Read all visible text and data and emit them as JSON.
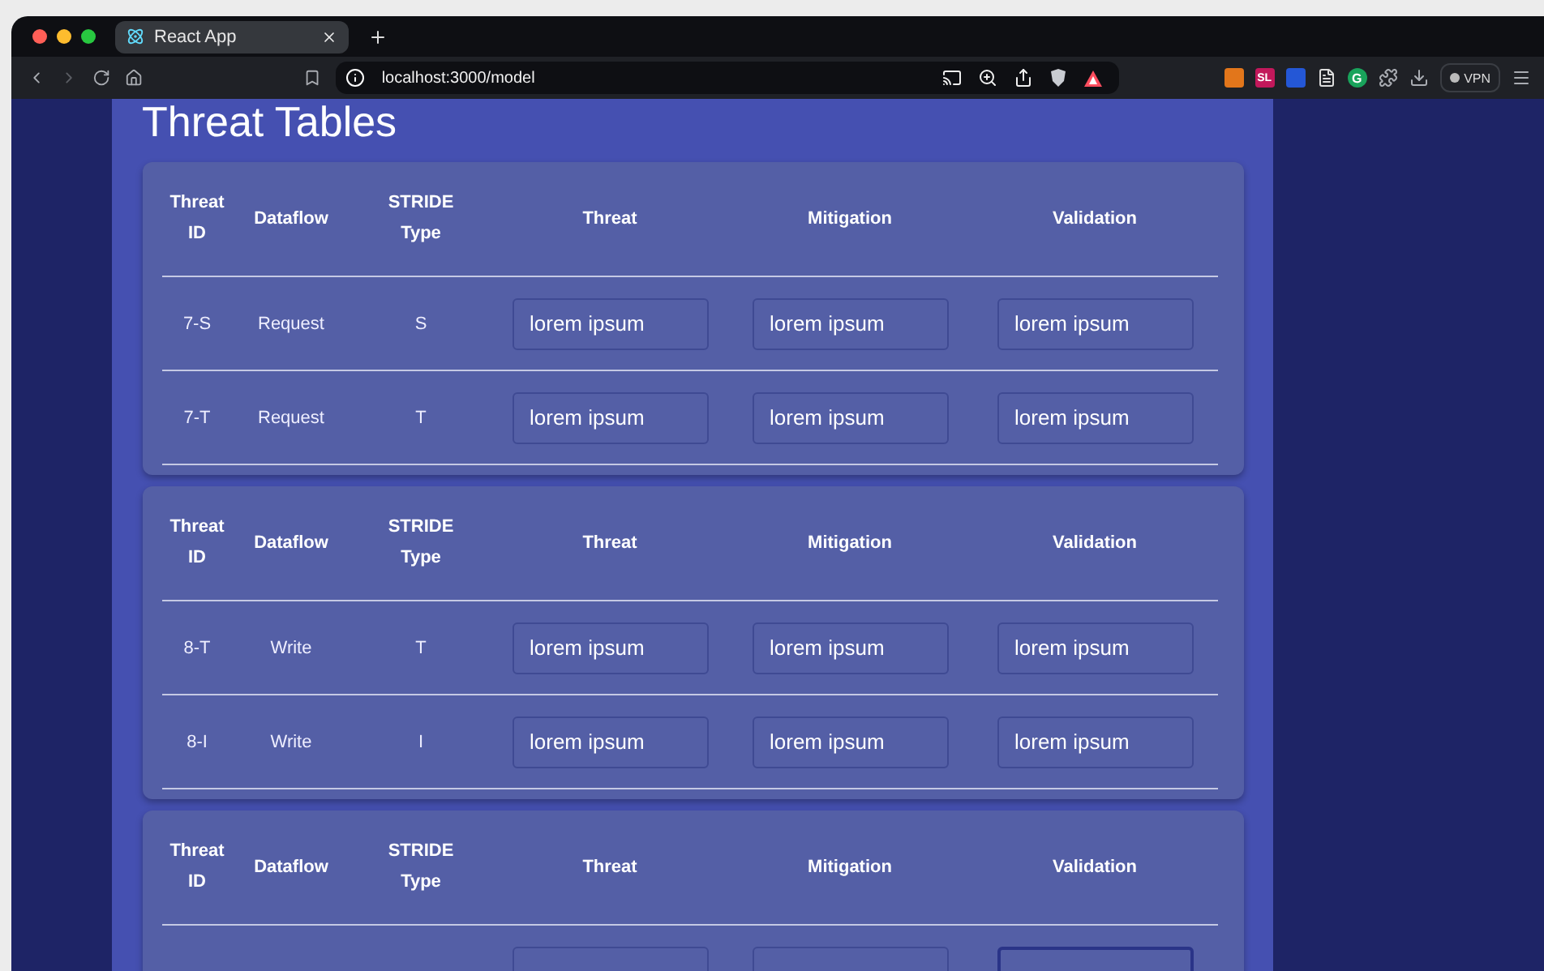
{
  "browser": {
    "tab_title": "React App",
    "url": "localhost:3000/model",
    "extensions": [
      "SL",
      "G"
    ],
    "vpn_label": "VPN"
  },
  "page": {
    "title": "Threat Tables",
    "tables": [
      {
        "columns": [
          "Threat ID",
          "Dataflow",
          "STRIDE Type",
          "Threat",
          "Mitigation",
          "Validation"
        ],
        "rows": [
          {
            "id": "7-S",
            "dataflow": "Request",
            "stride": "S",
            "fields": [
              {
                "value": "lorem ipsum",
                "focused": false
              },
              {
                "value": "lorem ipsum",
                "focused": false
              },
              {
                "value": "lorem ipsum",
                "focused": false
              }
            ]
          },
          {
            "id": "7-T",
            "dataflow": "Request",
            "stride": "T",
            "fields": [
              {
                "value": "lorem ipsum",
                "focused": false
              },
              {
                "value": "lorem ipsum",
                "focused": false
              },
              {
                "value": "lorem ipsum",
                "focused": false
              }
            ]
          }
        ]
      },
      {
        "columns": [
          "Threat ID",
          "Dataflow",
          "STRIDE Type",
          "Threat",
          "Mitigation",
          "Validation"
        ],
        "rows": [
          {
            "id": "8-T",
            "dataflow": "Write",
            "stride": "T",
            "fields": [
              {
                "value": "lorem ipsum",
                "focused": false
              },
              {
                "value": "lorem ipsum",
                "focused": false
              },
              {
                "value": "lorem ipsum",
                "focused": false
              }
            ]
          },
          {
            "id": "8-I",
            "dataflow": "Write",
            "stride": "I",
            "fields": [
              {
                "value": "lorem ipsum",
                "focused": false
              },
              {
                "value": "lorem ipsum",
                "focused": false
              },
              {
                "value": "lorem ipsum",
                "focused": false
              }
            ]
          }
        ]
      },
      {
        "columns": [
          "Threat ID",
          "Dataflow",
          "STRIDE Type",
          "Threat",
          "Mitigation",
          "Validation"
        ],
        "rows": [
          {
            "fields": [
              {
                "focused": false
              },
              {
                "focused": false
              },
              {
                "focused": true
              }
            ]
          }
        ]
      }
    ]
  }
}
